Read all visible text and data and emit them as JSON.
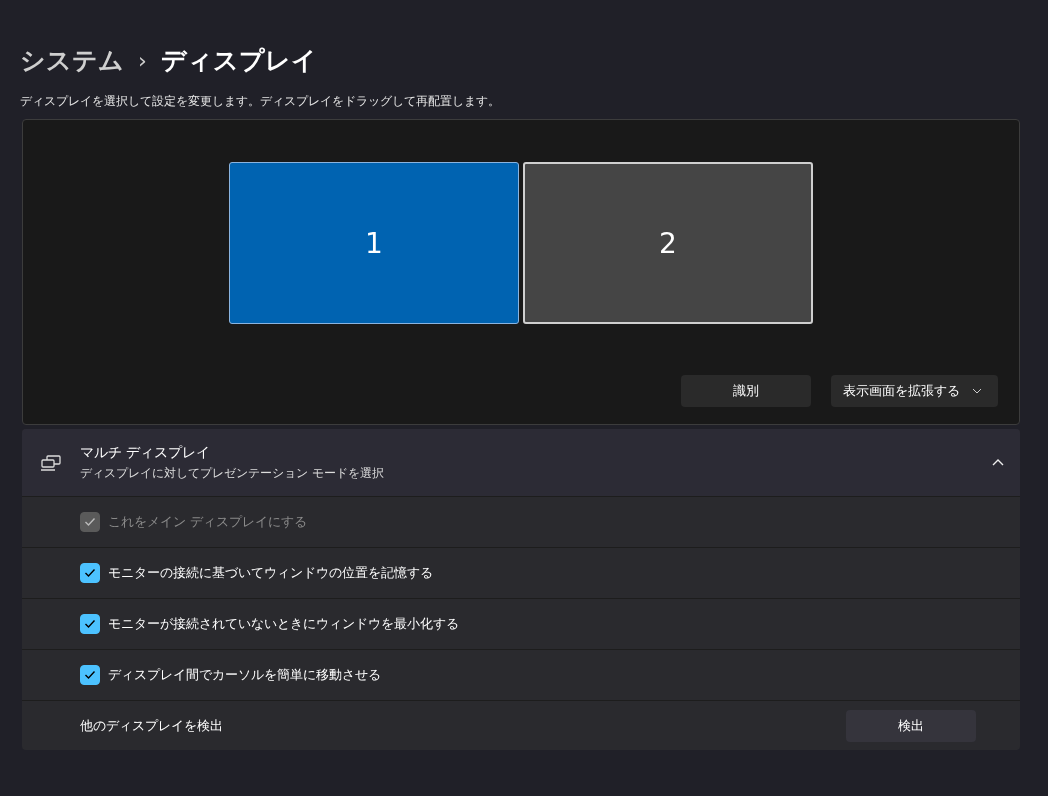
{
  "breadcrumb": {
    "parent": "システム",
    "separator": "›",
    "current": "ディスプレイ"
  },
  "description": "ディスプレイを選択して設定を変更します。ディスプレイをドラッグして再配置します。",
  "monitors": [
    {
      "label": "1",
      "selected": true
    },
    {
      "label": "2",
      "selected": false
    }
  ],
  "identify_button": "識別",
  "mode_dropdown": {
    "value": "表示画面を拡張する"
  },
  "multi_display": {
    "title": "マルチ ディスプレイ",
    "subtitle": "ディスプレイに対してプレゼンテーション モードを選択",
    "expanded": true,
    "options": [
      {
        "label": "これをメイン ディスプレイにする",
        "checked": true,
        "disabled": true
      },
      {
        "label": "モニターの接続に基づいてウィンドウの位置を記憶する",
        "checked": true,
        "disabled": false
      },
      {
        "label": "モニターが接続されていないときにウィンドウを最小化する",
        "checked": true,
        "disabled": false
      },
      {
        "label": "ディスプレイ間でカーソルを簡単に移動させる",
        "checked": true,
        "disabled": false
      }
    ],
    "detect": {
      "label": "他のディスプレイを検出",
      "button": "検出"
    }
  }
}
